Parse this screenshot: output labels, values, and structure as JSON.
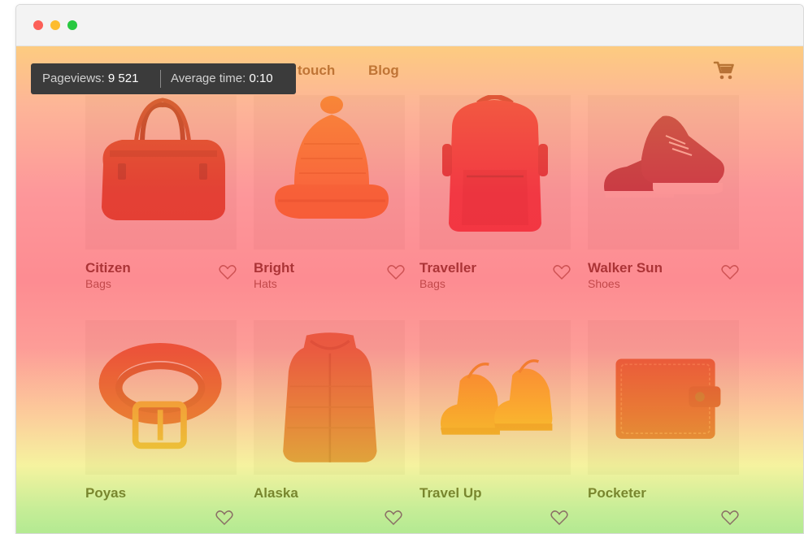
{
  "analytics": {
    "pageviews_label": "Pageviews:",
    "pageviews_value": "9 521",
    "avg_time_label": "Average time:",
    "avg_time_value": "0:10"
  },
  "nav": {
    "items": [
      {
        "label": "touch"
      },
      {
        "label": "Blog"
      }
    ],
    "cart_icon": "shopping-cart-icon"
  },
  "products": [
    {
      "name": "Citizen",
      "category": "Bags",
      "image": "duffel-bag"
    },
    {
      "name": "Bright",
      "category": "Hats",
      "image": "knit-hat"
    },
    {
      "name": "Traveller",
      "category": "Bags",
      "image": "backpack"
    },
    {
      "name": "Walker Sun",
      "category": "Shoes",
      "image": "sneakers"
    },
    {
      "name": "Poyas",
      "category": "",
      "image": "belt"
    },
    {
      "name": "Alaska",
      "category": "",
      "image": "vest"
    },
    {
      "name": "Travel Up",
      "category": "",
      "image": "boots"
    },
    {
      "name": "Pocketer",
      "category": "",
      "image": "wallet"
    }
  ],
  "colors": {
    "heat_top": "#ffaa28",
    "heat_mid": "#ff464b",
    "heat_bottom": "#78dc3c",
    "tooltip_bg": "#3b3b3b"
  }
}
